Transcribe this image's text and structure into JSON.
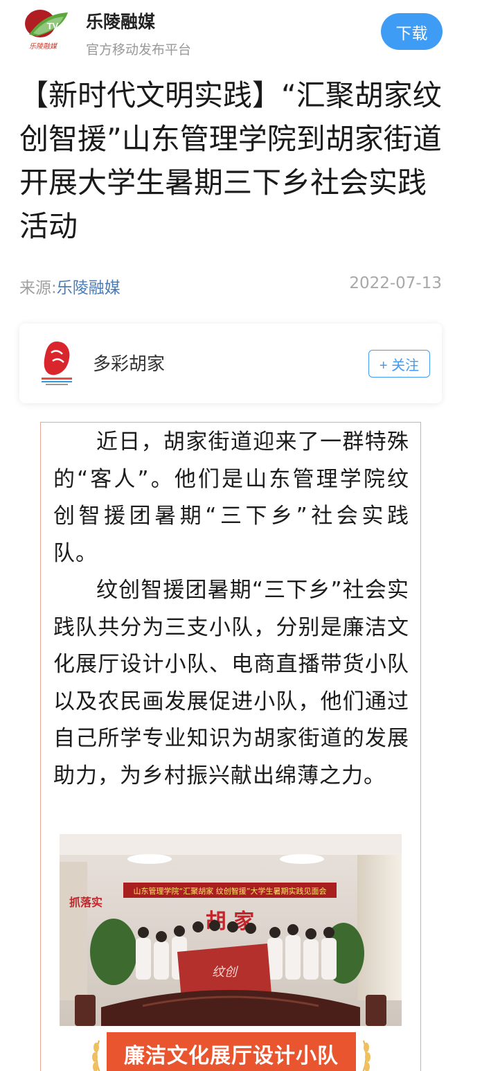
{
  "header": {
    "logo_text": "TV",
    "logo_caption": "乐陵融媒",
    "app_name": "乐陵融媒",
    "app_subtitle": "官方移动发布平台",
    "download_label": "下载"
  },
  "article": {
    "title": "【新时代文明实践】“汇聚胡家纹创智援”山东管理学院到胡家街道开展大学生暑期三下乡社会实践活动",
    "source_label": "来源:",
    "source_name": "乐陵融媒",
    "date": "2022-07-13"
  },
  "account": {
    "name": "多彩胡家",
    "follow_label": "+ 关注"
  },
  "content": {
    "paragraphs": [
      "近日，胡家街道迎来了一群特殊的“客人”。他们是山东管理学院纹创智援团暑期“三下乡”社会实践队。",
      "纹创智援团暑期“三下乡”社会实践队共分为三支小队，分别是廉洁文化展厅设计小队、电商直播带货小队以及农民画发展促进小队，他们通过自己所学专业知识为胡家街道的发展助力，为乡村振兴献出绵薄之力。"
    ],
    "photo_banner": "山东管理学院“汇聚胡家 纹创智援”大学生暑期实践见面会",
    "photo_wall_sign": "胡 家",
    "photo_side_sign": "抓落实",
    "section_banner": "廉洁文化展厅设计小队"
  },
  "colors": {
    "accent": "#3f9cf5",
    "banner": "#e8552f",
    "frame_border": "#e9a696",
    "source_link": "#4a7cb8"
  }
}
